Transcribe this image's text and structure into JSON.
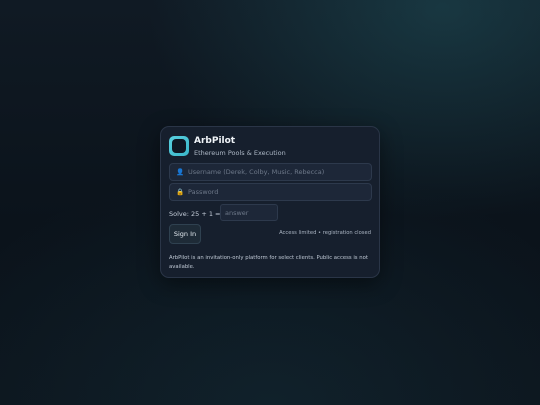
{
  "brand": {
    "name": "ArbPilot",
    "tagline": "Ethereum Pools & Execution",
    "logo_icon": "rounded-square-logo-icon",
    "accent_color": "#4fc6d8"
  },
  "login": {
    "username_placeholder": "Username (Derek, Colby, Music, Rebecca)",
    "username_icon": "user-icon",
    "password_placeholder": "Password",
    "password_icon": "lock-icon",
    "captcha_label": "Solve: 25 + 1 = ?",
    "captcha_placeholder": "answer",
    "signin_label": "Sign In",
    "access_note": "Access limited • registration closed"
  },
  "footer": {
    "notice": "ArbPilot is an invitation-only platform for select clients. Public access is not available."
  }
}
